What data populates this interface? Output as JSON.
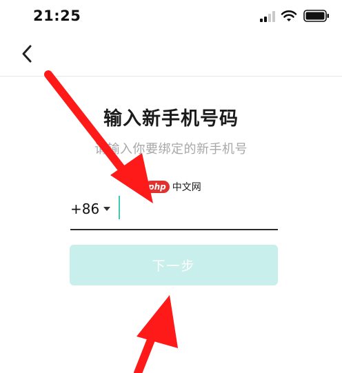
{
  "status_bar": {
    "time": "21:25",
    "icons": [
      "signal-icon",
      "wifi-icon",
      "battery-icon"
    ]
  },
  "nav": {
    "back_icon": "chevron-left-icon"
  },
  "main": {
    "title": "输入新手机号码",
    "subtitle": "请输入你要绑定的新手机号",
    "country_code": "+86",
    "phone_value": "",
    "next_label": "下一步"
  },
  "watermark": {
    "brand": "php",
    "text": "中文网"
  },
  "colors": {
    "accent": "#3fc7b3",
    "button_disabled": "#c8efeb",
    "annotation_arrow": "#ff1a1a"
  }
}
